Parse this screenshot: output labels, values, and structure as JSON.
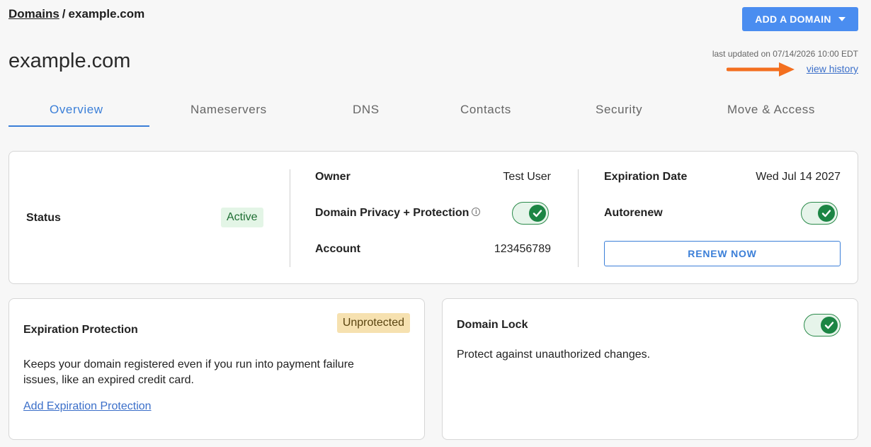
{
  "breadcrumb": {
    "root": "Domains",
    "separator": "/",
    "current": "example.com"
  },
  "header": {
    "add_domain_label": "ADD A DOMAIN",
    "title": "example.com",
    "last_updated": "last updated on 07/14/2026 10:00 EDT",
    "view_history": "view history"
  },
  "tabs": [
    {
      "label": "Overview",
      "active": true
    },
    {
      "label": "Nameservers",
      "active": false
    },
    {
      "label": "DNS",
      "active": false
    },
    {
      "label": "Contacts",
      "active": false
    },
    {
      "label": "Security",
      "active": false
    },
    {
      "label": "Move & Access",
      "active": false
    }
  ],
  "summary": {
    "status_label": "Status",
    "status_value": "Active",
    "owner_label": "Owner",
    "owner_value": "Test User",
    "privacy_label": "Domain Privacy + Protection",
    "privacy_enabled": true,
    "account_label": "Account",
    "account_value": "123456789",
    "expiration_label": "Expiration Date",
    "expiration_value": "Wed Jul 14 2027",
    "autorenew_label": "Autorenew",
    "autorenew_enabled": true,
    "renew_label": "RENEW NOW"
  },
  "expiration_protection": {
    "title": "Expiration Protection",
    "badge": "Unprotected",
    "description": "Keeps your domain registered even if you run into payment failure issues, like an expired credit card.",
    "link": "Add Expiration Protection"
  },
  "domain_lock": {
    "title": "Domain Lock",
    "enabled": true,
    "description": "Protect against unauthorized changes."
  },
  "colors": {
    "accent": "#3b7fd8",
    "primary_button": "#4a8df0",
    "toggle_on": "#1c8544",
    "annotation_arrow": "#f36f1f"
  },
  "icons": {
    "caret": "chevron-down-icon",
    "info": "info-icon",
    "check": "check-icon",
    "arrow": "arrow-right-icon"
  }
}
